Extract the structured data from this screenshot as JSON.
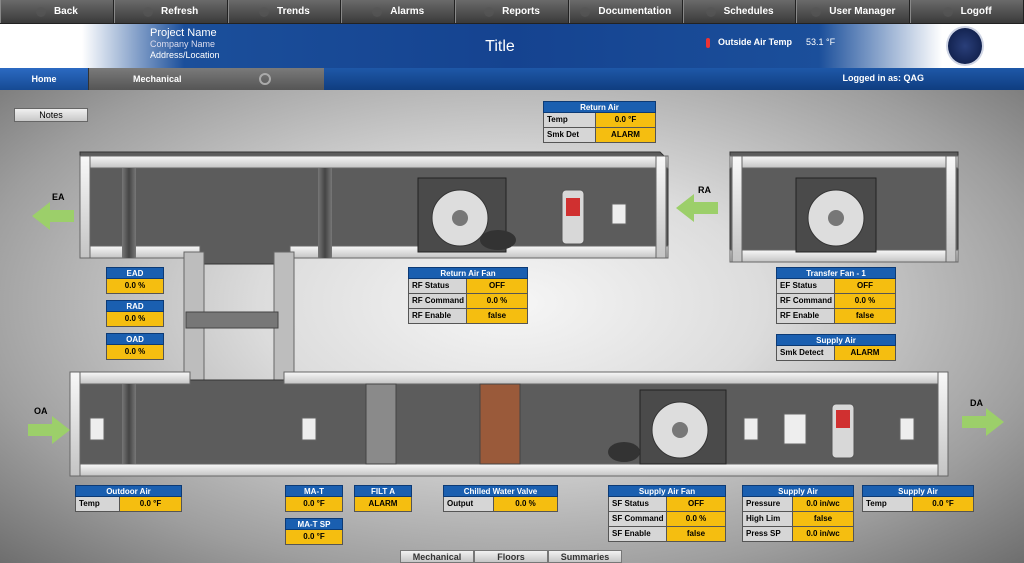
{
  "nav": [
    "Back",
    "Refresh",
    "Trends",
    "Alarms",
    "Reports",
    "Documentation",
    "Schedules",
    "User Manager",
    "Logoff"
  ],
  "header": {
    "project_name": "Project Name",
    "company_name": "Company Name",
    "address": "Address/Location",
    "title": "Title",
    "outside_air_label": "Outside Air Temp",
    "outside_air_value": "53.1 °F"
  },
  "tabs": {
    "home": "Home",
    "mechanical": "Mechanical",
    "logged_in": "Logged in as: QAG"
  },
  "notes_label": "Notes",
  "labels": {
    "ea": "EA",
    "ra": "RA",
    "oa": "OA",
    "da": "DA"
  },
  "panels": {
    "return_air": {
      "title": "Return Air",
      "rows": [
        [
          "Temp",
          "0.0 °F"
        ],
        [
          "Smk Det",
          "ALARM"
        ]
      ]
    },
    "return_air_fan": {
      "title": "Return Air Fan",
      "rows": [
        [
          "RF Status",
          "OFF"
        ],
        [
          "RF Command",
          "0.0 %"
        ],
        [
          "RF Enable",
          "false"
        ]
      ]
    },
    "transfer_fan": {
      "title": "Transfer Fan - 1",
      "rows": [
        [
          "EF Status",
          "OFF"
        ],
        [
          "RF Command",
          "0.0 %"
        ],
        [
          "RF Enable",
          "false"
        ]
      ]
    },
    "supply_air_smk": {
      "title": "Supply Air",
      "rows": [
        [
          "Smk Detect",
          "ALARM"
        ]
      ]
    },
    "ead": {
      "title": "EAD",
      "value": "0.0 %"
    },
    "rad": {
      "title": "RAD",
      "value": "0.0 %"
    },
    "oad": {
      "title": "OAD",
      "value": "0.0 %"
    },
    "outdoor_air": {
      "title": "Outdoor Air",
      "rows": [
        [
          "Temp",
          "0.0 °F"
        ]
      ]
    },
    "mat": {
      "title": "MA-T",
      "value": "0.0 °F"
    },
    "mat_sp": {
      "title": "MA-T SP",
      "value": "0.0 °F"
    },
    "filt": {
      "title": "FILT A",
      "value": "ALARM"
    },
    "chw_valve": {
      "title": "Chilled Water Valve",
      "rows": [
        [
          "Output",
          "0.0 %"
        ]
      ]
    },
    "supply_air_fan": {
      "title": "Supply Air Fan",
      "rows": [
        [
          "SF Status",
          "OFF"
        ],
        [
          "SF Command",
          "0.0 %"
        ],
        [
          "SF Enable",
          "false"
        ]
      ]
    },
    "supply_air_press": {
      "title": "Supply Air",
      "rows": [
        [
          "Pressure",
          "0.0 in/wc"
        ],
        [
          "High Lim",
          "false"
        ],
        [
          "Press SP",
          "0.0 in/wc"
        ]
      ]
    },
    "supply_air_temp": {
      "title": "Supply Air",
      "rows": [
        [
          "Temp",
          "0.0 °F"
        ]
      ]
    }
  },
  "bottom_tabs": [
    "Mechanical",
    "Floors",
    "Summaries"
  ]
}
